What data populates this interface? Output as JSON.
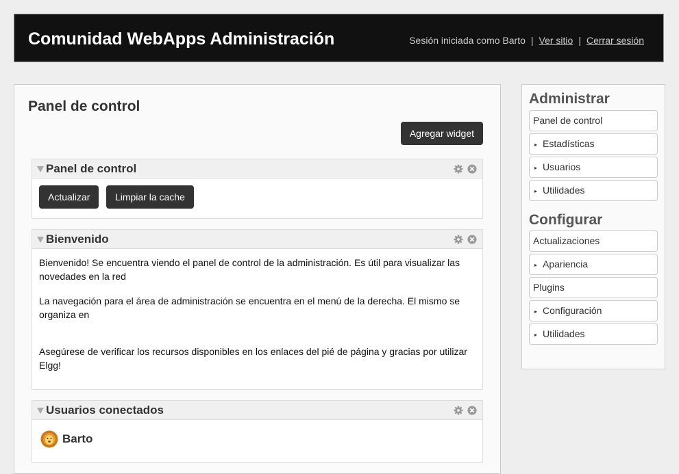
{
  "header": {
    "title": "Comunidad WebApps Administración",
    "session_text": "Sesión iniciada como Barto",
    "separator": "|",
    "view_site": "Ver sitio",
    "logout": "Cerrar sesión"
  },
  "main": {
    "title": "Panel de control",
    "add_widget": "Agregar widget"
  },
  "widgets": {
    "control": {
      "title": "Panel de control",
      "refresh": "Actualizar",
      "clear_cache": "Limpiar la cache"
    },
    "welcome": {
      "title": "Bienvenido",
      "p1": "Bienvenido! Se encuentra viendo el panel de control de la administración. Es útil para visualizar las novedades en la red",
      "p2": "La navegación para el área de administración se encuentra en el menú de la derecha. El mismo se organiza en",
      "p3": "Asegúrese de verificar los recursos disponibles en los enlaces del pié de página y gracias por utilizar Elgg!"
    },
    "online": {
      "title": "Usuarios conectados",
      "user": "Barto"
    }
  },
  "sidebar": {
    "admin_heading": "Administrar",
    "admin_items": [
      "Panel de control",
      "Estadísticas",
      "Usuarios",
      "Utilidades"
    ],
    "config_heading": "Configurar",
    "config_items": [
      "Actualizaciones",
      "Apariencia",
      "Plugins",
      "Configuración",
      "Utilidades"
    ],
    "arrow_glyph": "▸"
  },
  "icons": {
    "toggle": "triangle-down-icon",
    "settings": "gear-icon",
    "close": "close-icon",
    "avatar": "lion-avatar-icon"
  }
}
